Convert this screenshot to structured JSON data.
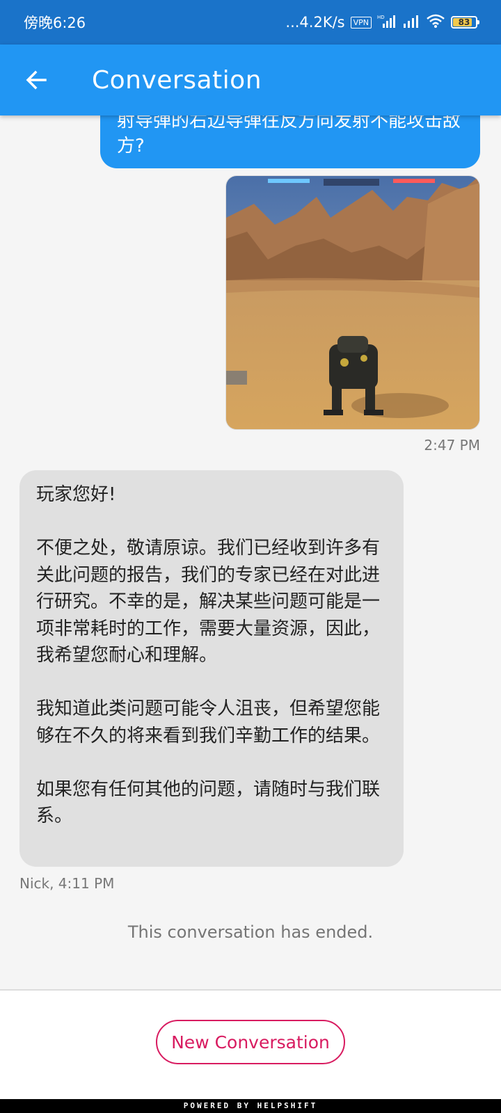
{
  "status_bar": {
    "time": "傍晚6:26",
    "network_speed": "...4.2K/s",
    "vpn_label": "VPN",
    "hd_label": "HD",
    "battery_level": "83"
  },
  "app_bar": {
    "title": "Conversation"
  },
  "messages": {
    "user_text": "射导弹的右边导弹往反方向发射不能攻击敌方?",
    "user_image_timestamp": "2:47 PM",
    "agent_paragraphs": [
      "玩家您好!",
      "不便之处，敬请原谅。我们已经收到许多有关此问题的报告，我们的专家已经在对此进行研究。不幸的是，解决某些问题可能是一项非常耗时的工作，需要大量资源，因此，我希望您耐心和理解。",
      "我知道此类问题可能令人沮丧，但希望您能够在不久的将来看到我们辛勤工作的结果。",
      "如果您有任何其他的问题，请随时与我们联系。"
    ],
    "agent_timestamp": "Nick, 4:11 PM"
  },
  "conversation_ended": "This conversation has ended.",
  "new_conversation_button": "New Conversation",
  "powered_by": "POWERED BY HELPSHIFT",
  "colors": {
    "status_bar": "#1a73c9",
    "app_bar": "#2196f3",
    "agent_bubble": "#e0e0e0",
    "accent_button": "#d81b60"
  }
}
